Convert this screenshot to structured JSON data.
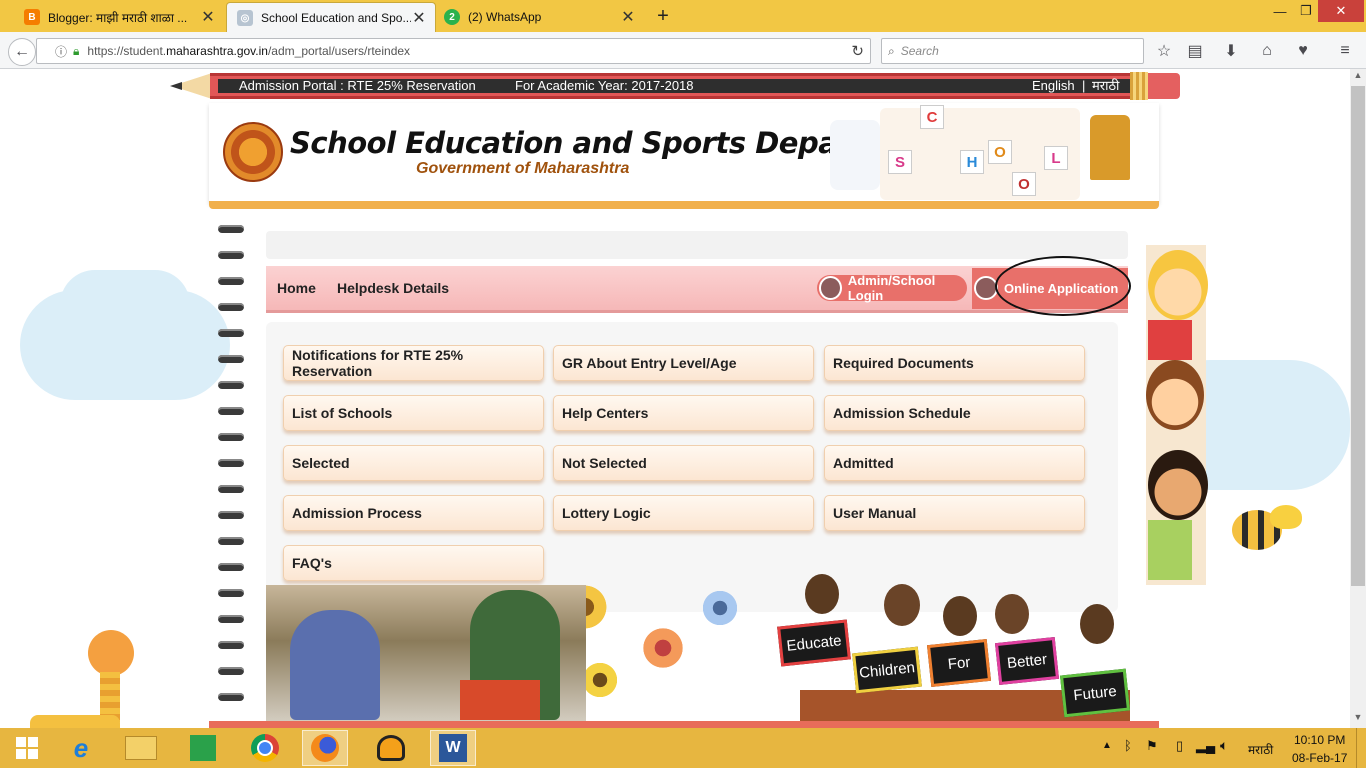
{
  "browser": {
    "tabs": [
      {
        "title": "Blogger: माझी मराठी शाळा ...",
        "icon": "blogger-icon",
        "active": false
      },
      {
        "title": "School Education and Spo...",
        "icon": "globe-icon",
        "active": true
      },
      {
        "title": "(2) WhatsApp",
        "icon": "whatsapp-icon",
        "badge": "2",
        "active": false
      }
    ],
    "new_tab_label": "+",
    "url": {
      "prefix": "https://student.",
      "domain": "maharashtra.gov.in",
      "path": "/adm_portal/users/rteindex"
    },
    "search_placeholder": "Search",
    "accent": "#f2c744"
  },
  "page": {
    "topbar": {
      "portal_label": "Admission Portal : RTE 25% Reservation",
      "academic_year": "For Academic Year: 2017-2018",
      "lang_english": "English",
      "lang_separator": "|",
      "lang_marathi": "मराठी"
    },
    "header": {
      "title": "School Education and Sports Department",
      "subtitle": "Government of Maharashtra",
      "school_letters": [
        "S",
        "C",
        "H",
        "O",
        "O",
        "L"
      ]
    },
    "menu": {
      "home": "Home",
      "helpdesk": "Helpdesk Details",
      "admin_login": "Admin/School Login",
      "online_application": "Online Application"
    },
    "buttons": [
      [
        "Notifications for RTE 25% Reservation",
        "GR About Entry Level/Age",
        "Required Documents"
      ],
      [
        "List of Schools",
        "Help Centers",
        "Admission Schedule"
      ],
      [
        "Selected",
        "Not Selected",
        "Admitted"
      ],
      [
        "Admission Process",
        "Lottery Logic",
        "User Manual"
      ],
      [
        "FAQ's"
      ]
    ],
    "boards": [
      "Educate",
      "Children",
      "For",
      "Better",
      "Future"
    ],
    "colors": {
      "menubar": "#f6b8b8",
      "button_bg": "#fce6d2",
      "pencil": "#e25757",
      "title_sub": "#a0520d"
    }
  },
  "taskbar": {
    "apps": [
      "windows-start",
      "internet-explorer",
      "file-explorer",
      "store",
      "chrome",
      "firefox",
      "audacity",
      "word"
    ],
    "tray": {
      "language": "मराठी",
      "time": "10:10 PM",
      "date": "08-Feb-17"
    }
  }
}
